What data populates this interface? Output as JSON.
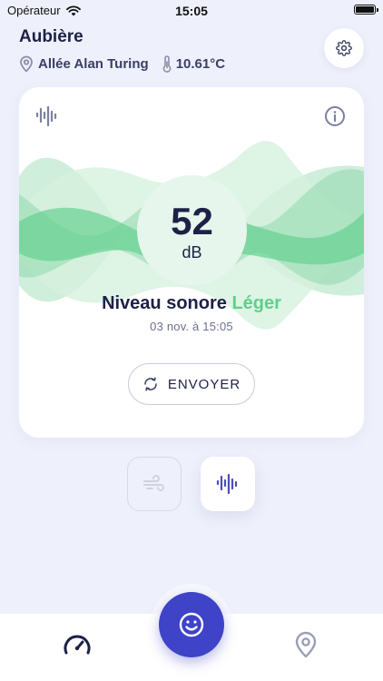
{
  "status_bar": {
    "carrier": "Opérateur",
    "time": "15:05"
  },
  "header": {
    "city": "Aubière",
    "street": "Allée Alan Turing",
    "temperature": "10.61°C"
  },
  "card": {
    "db_value": "52",
    "db_unit": "dB",
    "level_label": "Niveau sonore",
    "level_value": "Léger",
    "timestamp": "03 nov. à 15:05",
    "send_label": "ENVOYER"
  },
  "colors": {
    "accent": "#3f43c8",
    "navy": "#1d2147",
    "green": "#5fcf8c",
    "light_green": "#d6f1df",
    "background": "#eef0fb"
  },
  "icons": {
    "settings": "gear-icon",
    "location": "location-pin-icon",
    "thermometer": "thermometer-icon",
    "sound_wave": "sound-wave-icon",
    "info": "info-icon",
    "refresh": "refresh-icon",
    "wind": "wind-icon",
    "gauge": "gauge-icon",
    "smiley": "smiley-icon"
  },
  "mode_selector": {
    "selected": "sound"
  },
  "tabbar": {
    "selected": "gauge"
  }
}
